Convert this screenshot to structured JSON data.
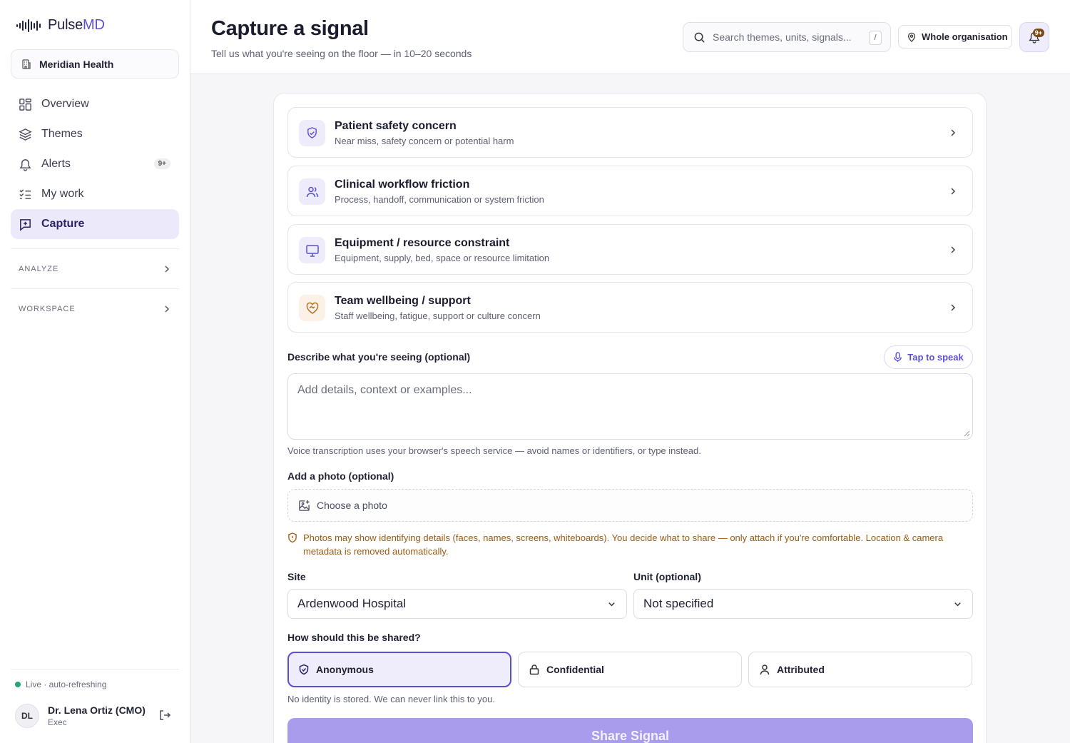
{
  "app": {
    "logo_prefix": "Pulse",
    "logo_suffix": "MD",
    "organization": "Meridian Health"
  },
  "sidebar": {
    "nav": [
      {
        "label": "Overview",
        "icon": "grid-icon"
      },
      {
        "label": "Themes",
        "icon": "layers-icon"
      },
      {
        "label": "Alerts",
        "icon": "bell-icon",
        "badge": "9+"
      },
      {
        "label": "My work",
        "icon": "checklist-icon"
      },
      {
        "label": "Capture",
        "icon": "message-plus-icon",
        "active": true
      }
    ],
    "sections": [
      {
        "label": "ANALYZE"
      },
      {
        "label": "WORKSPACE"
      }
    ],
    "status": "Live · auto-refreshing",
    "user": {
      "initials": "DL",
      "name": "Dr. Lena Ortiz (CMO)",
      "role": "Exec"
    }
  },
  "header": {
    "title": "Capture a signal",
    "subtitle": "Tell us what you're seeing on the floor — in 10–20 seconds",
    "search_placeholder": "Search themes, units, signals...",
    "search_shortcut": "/",
    "scope_label": "Whole organisation",
    "notifications_badge": "9+"
  },
  "form": {
    "categories": [
      {
        "title": "Patient safety concern",
        "desc": "Near miss, safety concern or potential harm",
        "icon": "shield-check-icon"
      },
      {
        "title": "Clinical workflow friction",
        "desc": "Process, handoff, communication or system friction",
        "icon": "users-icon"
      },
      {
        "title": "Equipment / resource constraint",
        "desc": "Equipment, supply, bed, space or resource limitation",
        "icon": "monitor-icon"
      },
      {
        "title": "Team wellbeing / support",
        "desc": "Staff wellbeing, fatigue, support or culture concern",
        "icon": "heart-handshake-icon"
      }
    ],
    "describe_label": "Describe what you're seeing (optional)",
    "speak_label": "Tap to speak",
    "describe_placeholder": "Add details, context or examples...",
    "voice_hint": "Voice transcription uses your browser's speech service — avoid names or identifiers, or type instead.",
    "photo_label": "Add a photo (optional)",
    "photo_button": "Choose a photo",
    "photo_warning": "Photos may show identifying details (faces, names, screens, whiteboards). You decide what to share — only attach if you're comfortable. Location & camera metadata is removed automatically.",
    "site_label": "Site",
    "site_value": "Ardenwood Hospital",
    "unit_label": "Unit (optional)",
    "unit_value": "Not specified",
    "share_label": "How should this be shared?",
    "share_options": [
      {
        "label": "Anonymous",
        "icon": "shield-icon",
        "selected": true
      },
      {
        "label": "Confidential",
        "icon": "lock-icon"
      },
      {
        "label": "Attributed",
        "icon": "user-icon"
      }
    ],
    "share_hint": "No identity is stored. We can never link this to you.",
    "submit_label": "Share Signal"
  },
  "colors": {
    "accent": "#5b4fd6",
    "accent_soft": "#ece9fb",
    "warning": "#9a5a12",
    "live": "#22a67a",
    "submit_disabled": "#a99cec"
  }
}
